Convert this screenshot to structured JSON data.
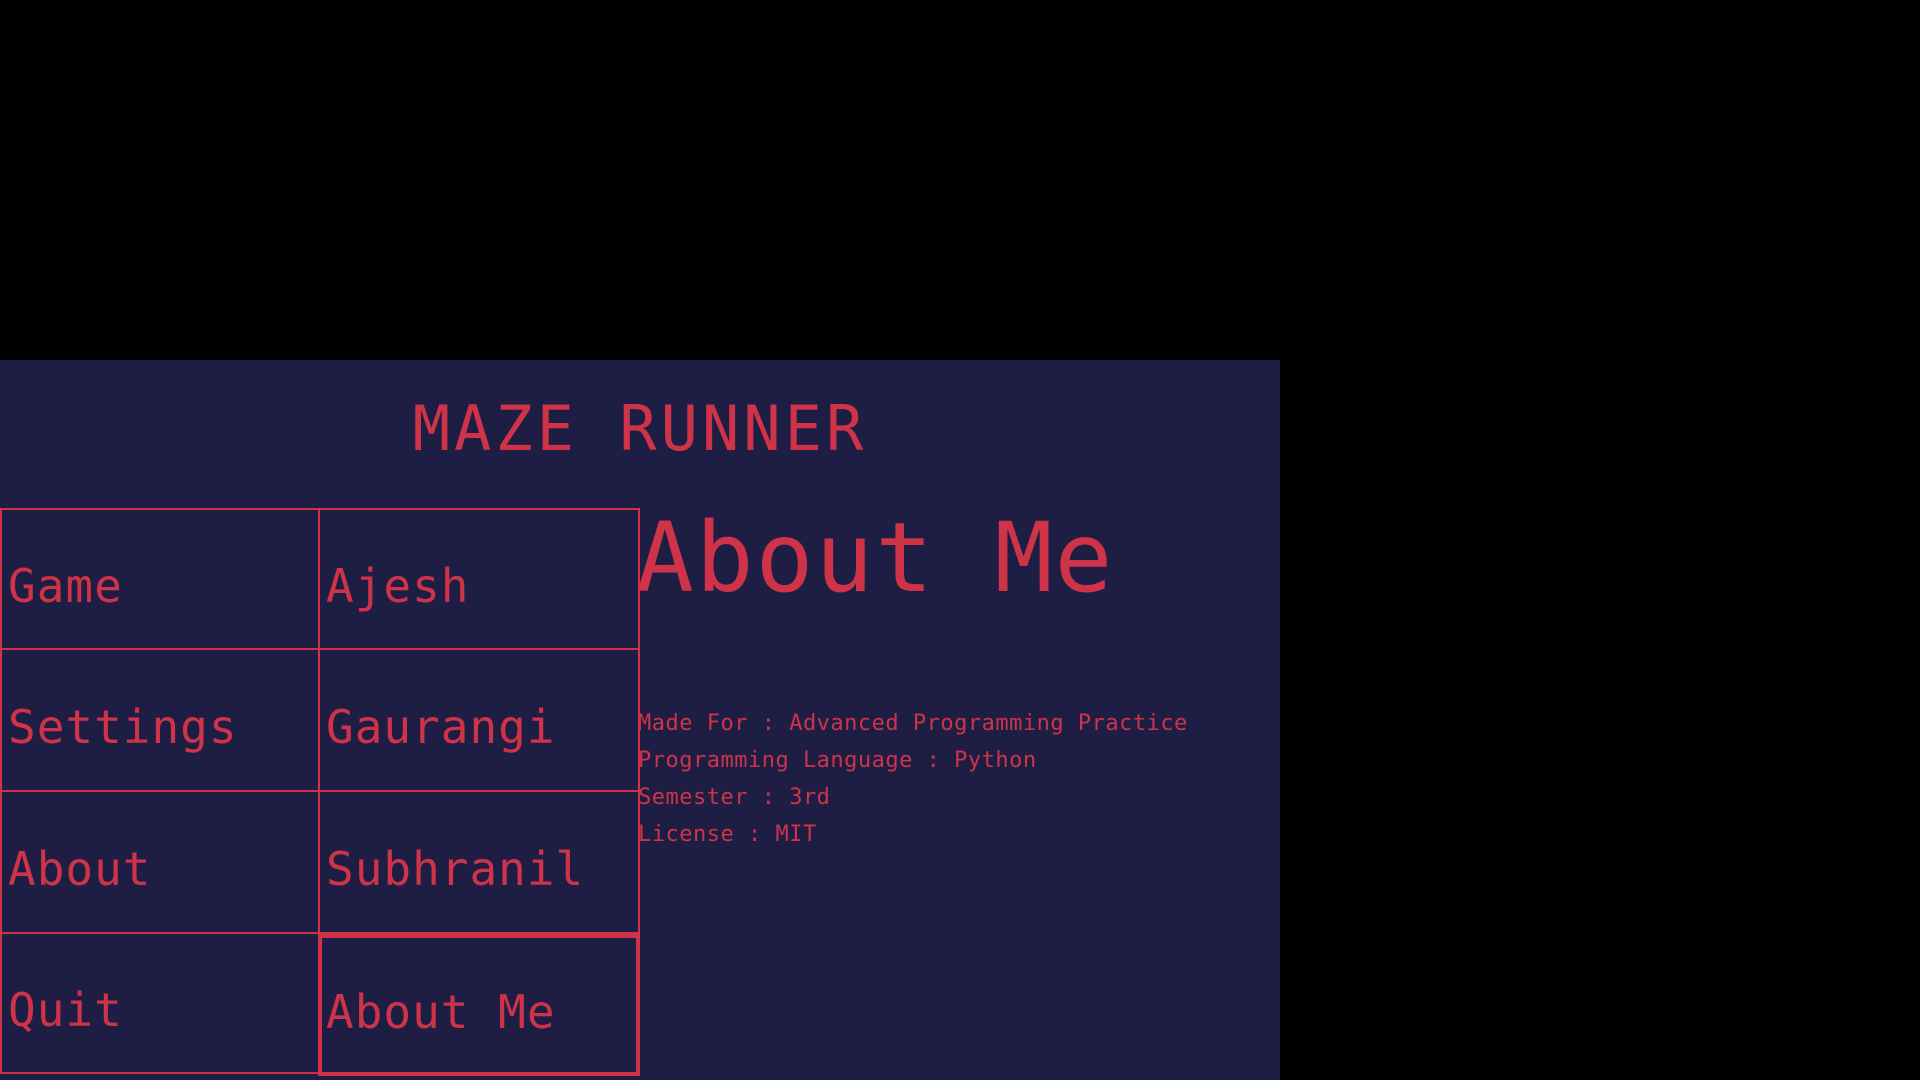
{
  "game": {
    "title": "MAZE RUNNER",
    "colors": {
      "background": "#1e1e45",
      "accent": "#cf3347",
      "outside": "#000000"
    }
  },
  "menu": {
    "left": [
      {
        "label": "Game"
      },
      {
        "label": "Settings"
      },
      {
        "label": "About"
      },
      {
        "label": "Quit"
      }
    ],
    "right": [
      {
        "label": "Ajesh"
      },
      {
        "label": "Gaurangi"
      },
      {
        "label": "Subhranil"
      },
      {
        "label": "About Me",
        "selected": true
      }
    ]
  },
  "about": {
    "title": "About Me",
    "lines": [
      "Made For : Advanced Programming Practice",
      "Programming Language : Python",
      "Semester : 3rd",
      "License : MIT"
    ]
  }
}
